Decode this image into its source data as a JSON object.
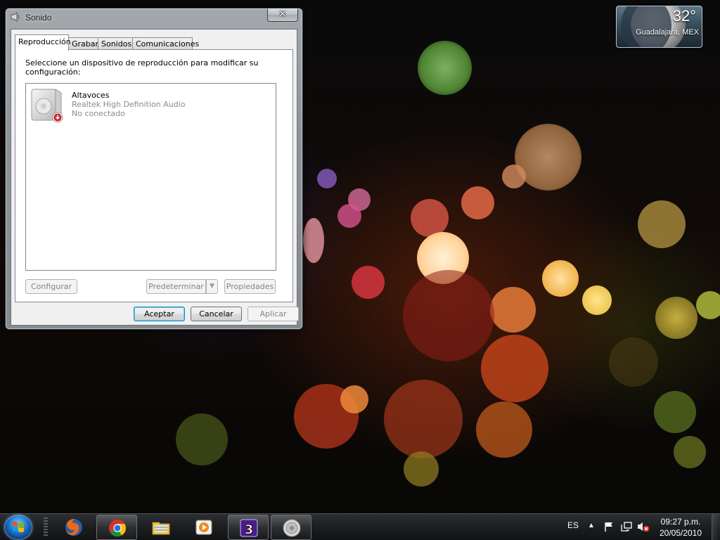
{
  "desktop": {
    "weather": {
      "temperature": "32°",
      "location": "Guadalajara, MEX"
    }
  },
  "window": {
    "title": "Sonido",
    "close_label": "✕",
    "tabs": [
      {
        "label": "Reproducción",
        "active": true
      },
      {
        "label": "Grabar",
        "active": false
      },
      {
        "label": "Sonidos",
        "active": false
      },
      {
        "label": "Comunicaciones",
        "active": false
      }
    ],
    "instructions": "Seleccione un dispositivo de reproducción para modificar su configuración:",
    "devices": [
      {
        "name": "Altavoces",
        "driver": "Realtek High Definition Audio",
        "status": "No conectado"
      }
    ],
    "buttons": {
      "configure": "Configurar",
      "set_default": "Predeterminar",
      "properties": "Propiedades",
      "ok": "Aceptar",
      "cancel": "Cancelar",
      "apply": "Aplicar"
    }
  },
  "taskbar": {
    "pinned": [
      {
        "name": "firefox-icon",
        "open": false
      },
      {
        "name": "chrome-icon",
        "open": true
      },
      {
        "name": "explorer-icon",
        "open": false
      },
      {
        "name": "media-player-icon",
        "open": false
      },
      {
        "name": "game-3-icon",
        "open": true
      },
      {
        "name": "sound-icon",
        "open": true
      }
    ],
    "tray": {
      "language": "ES",
      "time": "09:27 p.m.",
      "date": "20/05/2010",
      "icons": [
        "show-hidden-icon",
        "action-center-flag-icon",
        "network-icon",
        "volume-muted-icon"
      ]
    }
  }
}
